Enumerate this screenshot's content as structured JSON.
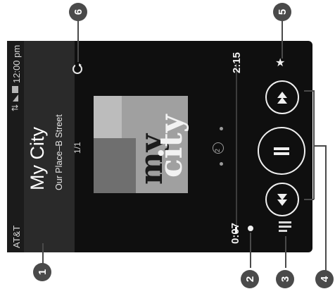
{
  "status": {
    "carrier": "AT&T",
    "time": "12:00 pm"
  },
  "now_playing": {
    "title": "My City",
    "subtitle": "Our Place–B Street",
    "track_count": "1/1",
    "album_art_text": [
      "my",
      "city"
    ],
    "page_indicator": "2"
  },
  "playback": {
    "elapsed": "0:07",
    "total": "2:15",
    "progress_fraction": 0.05
  },
  "callouts": [
    "1",
    "2",
    "3",
    "4",
    "5",
    "6"
  ],
  "icons": {
    "star": "star-icon",
    "playlist": "playlist-icon",
    "previous": "previous-icon",
    "pause": "pause-icon",
    "next": "next-icon",
    "repeat": "repeat-icon"
  }
}
